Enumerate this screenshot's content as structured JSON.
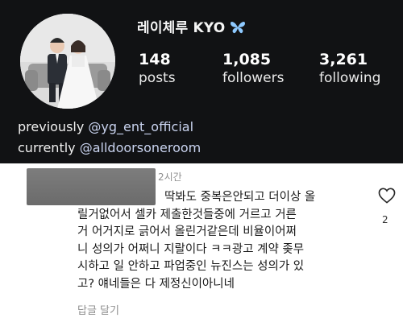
{
  "profile": {
    "username": "레이체루 KYO",
    "stats": [
      {
        "value": "148",
        "label": "posts"
      },
      {
        "value": "1,085",
        "label": "followers"
      },
      {
        "value": "3,261",
        "label": "following"
      }
    ],
    "bio": {
      "line1_prefix": "previously ",
      "line1_handle": "@yg_ent_official",
      "line2_prefix": "currently ",
      "line2_handle": "@alldoorsoneroom"
    }
  },
  "comment": {
    "time_ago": "2시간",
    "lines": [
      "딱봐도 중복은안되고 더이상 올",
      "릴거없어서 셀카 제출한것들중에 거르고 거른",
      "거 어거지로 긁어서 올린거같은데 비율이어쩌",
      "니 성의가 어쩌니 지랄이다 ㅋㅋ광고 계약 좆무",
      "시하고 일 안하고 파업중인 뉴진스는 성의가 있",
      "고? 얘네들은 다 제정신이아니네"
    ],
    "reply_label": "답글 달기",
    "like_count": "2"
  },
  "colors": {
    "profile_bg": "#111214",
    "handle": "#c9d3ef",
    "butterfly": "#8ec9ff",
    "muted": "#8e8e8e"
  },
  "icons": [
    "butterfly-icon",
    "heart-icon"
  ]
}
